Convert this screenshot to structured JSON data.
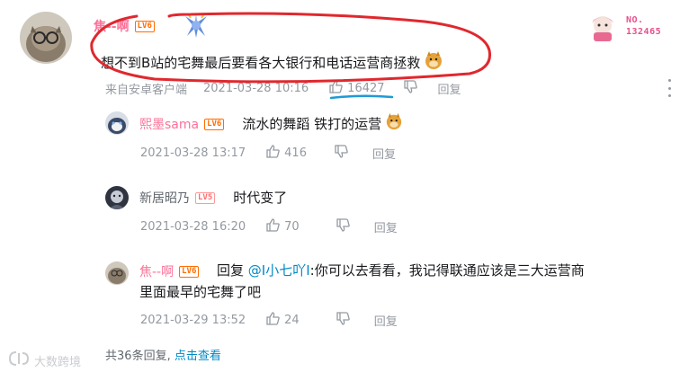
{
  "main_comment": {
    "username": "焦--啊",
    "level": "LV6",
    "text": "想不到B站的宅舞最后要看各大银行和电话运营商拯救",
    "source": "来自安卓客户端",
    "time": "2021-03-28 10:16",
    "likes": "16427",
    "reply_label": "回复",
    "badge_no_label": "NO.",
    "badge_no_value": "132465"
  },
  "replies": [
    {
      "username": "熙墨sama",
      "level": "LV6",
      "text": "流水的舞蹈 铁打的运营",
      "time": "2021-03-28 13:17",
      "likes": "416",
      "reply_label": "回复"
    },
    {
      "username": "新居昭乃",
      "level": "LV5",
      "text": "时代变了",
      "time": "2021-03-28 16:20",
      "likes": "70",
      "reply_label": "回复"
    },
    {
      "username": "焦--啊",
      "level": "LV6",
      "reply_prefix": "回复",
      "mention": "@I小七吖I",
      "text": ":你可以去看看，我记得联通应该是三大运营商里面最早的宅舞了吧",
      "time": "2021-03-29 13:52",
      "likes": "24",
      "reply_label": "回复"
    }
  ],
  "footer": {
    "total_prefix": "共",
    "total_count": "36",
    "total_suffix": "条回复,",
    "view_link": "点击查看"
  },
  "watermark": "大数跨境",
  "colors": {
    "username_vip": "#fb7299",
    "link": "#008ac5",
    "meta": "#9499a0",
    "annotation_red": "#e0282e",
    "annotation_blue": "#1e9bd7"
  }
}
